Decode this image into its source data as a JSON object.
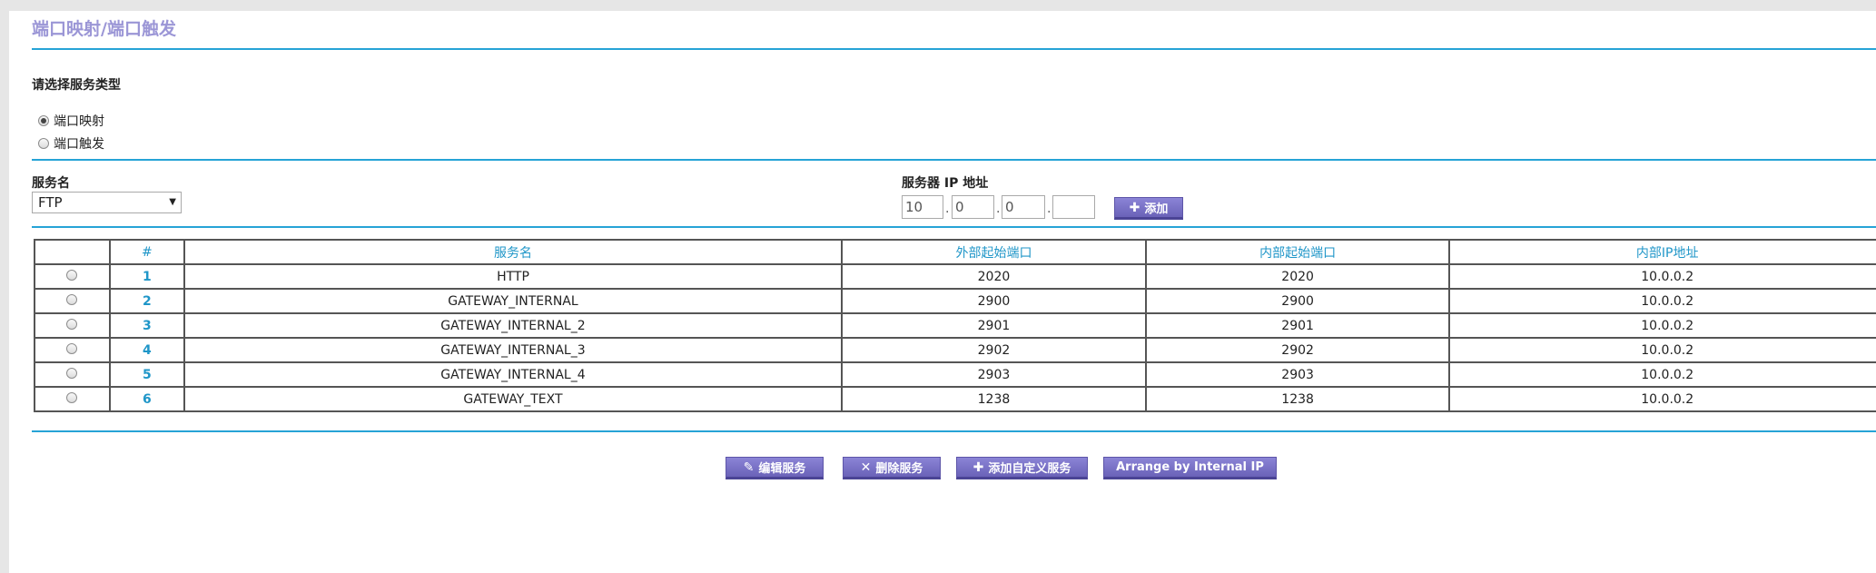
{
  "page": {
    "title": "端口映射/端口触发"
  },
  "service_type": {
    "label": "请选择服务类型",
    "options": [
      {
        "label": "端口映射",
        "checked": true
      },
      {
        "label": "端口触发",
        "checked": false
      }
    ]
  },
  "form": {
    "service_name_label": "服务名",
    "service_name_value": "FTP",
    "server_ip_label": "服务器 IP 地址",
    "ip_octets": [
      "10",
      "0",
      "0",
      ""
    ],
    "add_button": "添加"
  },
  "table": {
    "headers": [
      "",
      "#",
      "服务名",
      "外部起始端口",
      "内部起始端口",
      "内部IP地址"
    ],
    "rows": [
      {
        "num": "1",
        "name": "HTTP",
        "ext_port": "2020",
        "int_port": "2020",
        "ip": "10.0.0.2"
      },
      {
        "num": "2",
        "name": "GATEWAY_INTERNAL",
        "ext_port": "2900",
        "int_port": "2900",
        "ip": "10.0.0.2"
      },
      {
        "num": "3",
        "name": "GATEWAY_INTERNAL_2",
        "ext_port": "2901",
        "int_port": "2901",
        "ip": "10.0.0.2"
      },
      {
        "num": "4",
        "name": "GATEWAY_INTERNAL_3",
        "ext_port": "2902",
        "int_port": "2902",
        "ip": "10.0.0.2"
      },
      {
        "num": "5",
        "name": "GATEWAY_INTERNAL_4",
        "ext_port": "2903",
        "int_port": "2903",
        "ip": "10.0.0.2"
      },
      {
        "num": "6",
        "name": "GATEWAY_TEXT",
        "ext_port": "1238",
        "int_port": "1238",
        "ip": "10.0.0.2"
      }
    ]
  },
  "actions": {
    "edit": "编辑服务",
    "delete": "删除服务",
    "add_custom": "添加自定义服务",
    "arrange": "Arrange by Internal IP"
  },
  "colors": {
    "accent_line": "#26a3d6",
    "title": "#9b96d6",
    "button": "#6a62b8",
    "header_text": "#1f96c8"
  },
  "icons": {
    "add": "plus-icon",
    "edit": "pencil-icon",
    "delete": "x-icon"
  }
}
